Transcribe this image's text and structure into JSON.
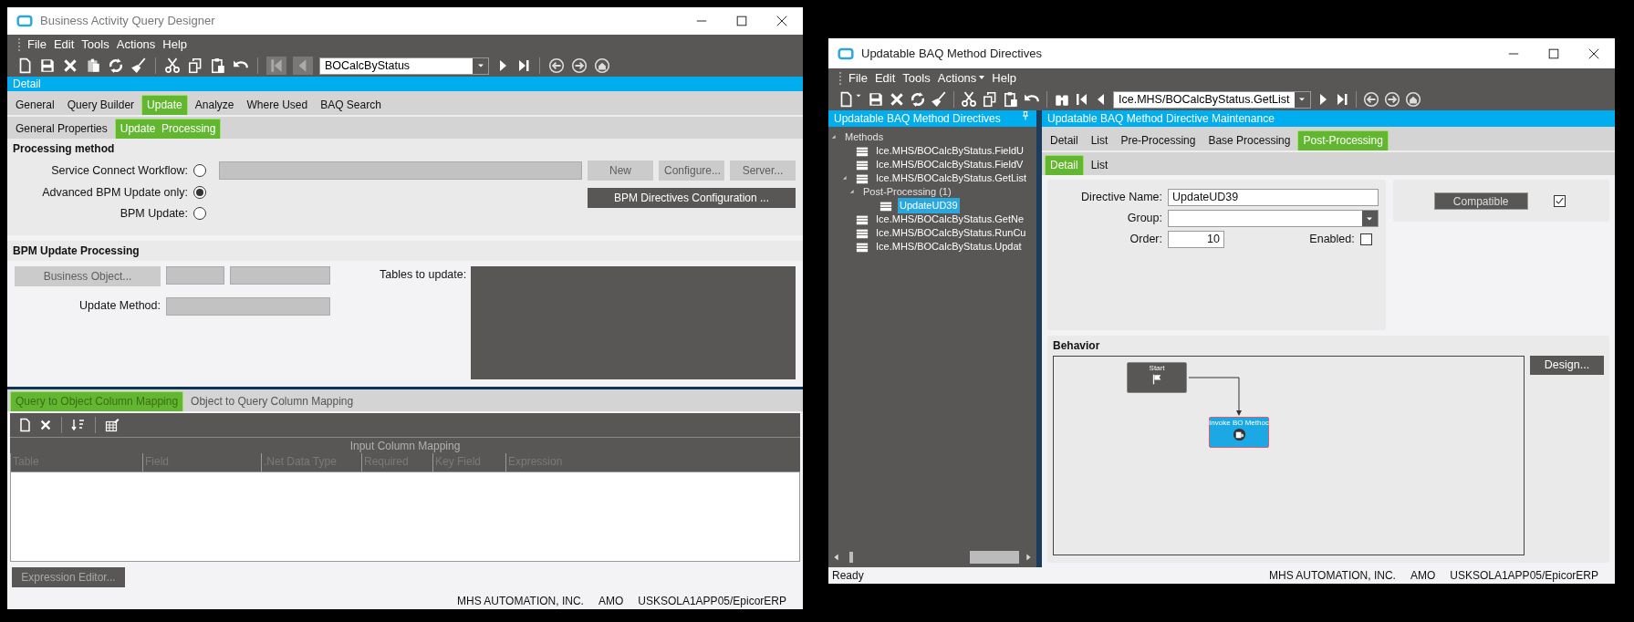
{
  "query_designer": {
    "title": "Business Activity Query Designer",
    "menu": [
      {
        "label": "File",
        "submenu": false
      },
      {
        "label": "Edit",
        "submenu": false
      },
      {
        "label": "Tools",
        "submenu": false
      },
      {
        "label": "Actions",
        "submenu": false
      },
      {
        "label": "Help",
        "submenu": false
      }
    ],
    "record": {
      "value": "BOCalcByStatus"
    },
    "panel_title": "Detail",
    "tabs": [
      {
        "label": "General",
        "selected": false
      },
      {
        "label": "Query Builder",
        "selected": false
      },
      {
        "label": "Update",
        "selected": true
      },
      {
        "label": "Analyze",
        "selected": false
      },
      {
        "label": "Where Used",
        "selected": false
      },
      {
        "label": "BAQ Search",
        "selected": false
      }
    ],
    "subtabs": [
      {
        "label": "General Properties",
        "selected": false
      },
      {
        "label": "Update  Processing",
        "selected": true
      }
    ],
    "processing_method": {
      "title": "Processing method",
      "options": [
        {
          "label": "Service Connect Workflow:",
          "selected": false
        },
        {
          "label": "Advanced BPM Update only:",
          "selected": true
        },
        {
          "label": "BPM Update:",
          "selected": false
        }
      ],
      "buttons": [
        {
          "label": "New",
          "disabled": true
        },
        {
          "label": "Configure...",
          "disabled": true
        },
        {
          "label": "Server...",
          "disabled": true
        }
      ],
      "directives_button": {
        "label": "BPM Directives Configuration ...",
        "disabled": false
      }
    },
    "bpm_update": {
      "title": "BPM Update Processing",
      "business_object_button": {
        "label": "Business Object...",
        "disabled": true
      },
      "update_method_label": "Update Method:",
      "tables_label": "Tables to update:"
    },
    "mapping_tabs": [
      {
        "label": "Query to Object Column Mapping",
        "selected": true
      },
      {
        "label": "Object to Query Column Mapping",
        "selected": false
      }
    ],
    "grid": {
      "band": "Input Column Mapping",
      "columns": [
        "Table",
        "Field",
        ".Net Data Type",
        "Required",
        "Key Field",
        "Expression"
      ]
    },
    "expression_button": {
      "label": "Expression Editor...",
      "disabled": true
    },
    "status_bar": [
      "MHS AUTOMATION, INC.",
      "AMO",
      "USKSOLA1APP05/EpicorERP"
    ]
  },
  "method_directives": {
    "title": "Updatable BAQ Method Directives",
    "menu": [
      {
        "label": "File",
        "submenu": false
      },
      {
        "label": "Edit",
        "submenu": false
      },
      {
        "label": "Tools",
        "submenu": false
      },
      {
        "label": "Actions",
        "submenu": true
      },
      {
        "label": "Help",
        "submenu": false
      }
    ],
    "record": {
      "value": "Ice.MHS/BOCalcByStatus.GetList"
    },
    "tree_title": "Updatable BAQ Method Directives",
    "tree": [
      {
        "label": "Methods",
        "kind": "group",
        "expanded": true,
        "selected": false,
        "children": [
          {
            "label": "Ice.MHS/BOCalcByStatus.FieldU",
            "kind": "method",
            "selected": false
          },
          {
            "label": "Ice.MHS/BOCalcByStatus.FieldV",
            "kind": "method",
            "selected": false
          },
          {
            "label": "Ice.MHS/BOCalcByStatus.GetList",
            "kind": "method",
            "expanded": true,
            "selected": false,
            "children": [
              {
                "label": "Post-Processing (1)",
                "kind": "group",
                "expanded": true,
                "selected": false,
                "children": [
                  {
                    "label": "UpdateUD39",
                    "kind": "method",
                    "selected": true
                  }
                ]
              }
            ]
          },
          {
            "label": "Ice.MHS/BOCalcByStatus.GetNe",
            "kind": "method",
            "selected": false
          },
          {
            "label": "Ice.MHS/BOCalcByStatus.RunCu",
            "kind": "method",
            "selected": false
          },
          {
            "label": "Ice.MHS/BOCalcByStatus.Updat",
            "kind": "method",
            "selected": false
          }
        ]
      }
    ],
    "main_title": "Updatable BAQ Method Directive Maintenance",
    "tabs": [
      {
        "label": "Detail",
        "selected": false
      },
      {
        "label": "List",
        "selected": false
      },
      {
        "label": "Pre-Processing",
        "selected": false
      },
      {
        "label": "Base Processing",
        "selected": false
      },
      {
        "label": "Post-Processing",
        "selected": true
      }
    ],
    "subtabs": [
      {
        "label": "Detail",
        "selected": true
      },
      {
        "label": "List",
        "selected": false
      }
    ],
    "form": {
      "directive_name": {
        "label": "Directive Name:",
        "value": "UpdateUD39"
      },
      "group": {
        "label": "Group:"
      },
      "order": {
        "label": "Order:",
        "value": "10"
      },
      "enabled": {
        "label": "Enabled:",
        "checked": false
      }
    },
    "compatible": {
      "label": "Compatible",
      "checked": true
    },
    "behavior": {
      "title": "Behavior",
      "design_button": "Design...",
      "nodes": [
        {
          "label": "Start",
          "kind": "start"
        },
        {
          "label": "Invoke BO Methoc",
          "kind": "invoke"
        }
      ]
    },
    "status_bar": [
      "Ready",
      "MHS AUTOMATION, INC.",
      "AMO",
      "USKSOLA1APP05/EpicorERP"
    ]
  }
}
